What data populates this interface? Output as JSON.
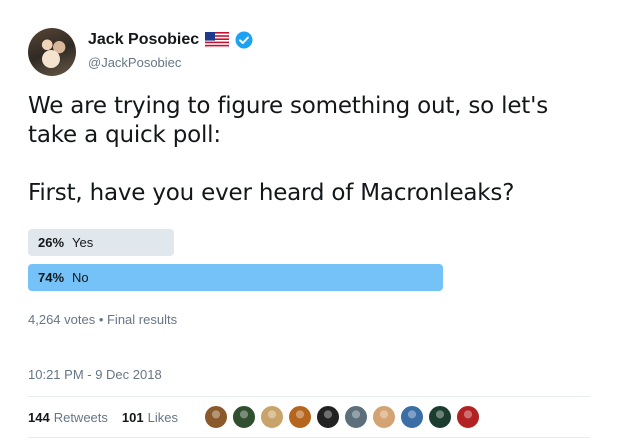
{
  "author": {
    "display_name": "Jack Posobiec",
    "handle": "@JackPosobiec",
    "flag_icon": "us-flag-icon",
    "verified_icon": "verified-badge-icon"
  },
  "tweet": {
    "text": "We are trying to figure something out, so let's take a quick poll:\n\nFirst, have you ever heard of Macronleaks?"
  },
  "poll": {
    "options": [
      {
        "percent_label": "26%",
        "label": "Yes",
        "fraction": 0.26
      },
      {
        "percent_label": "74%",
        "label": "No",
        "fraction": 0.74
      }
    ],
    "meta": "4,264 votes • Final results"
  },
  "timestamp": "10:21 PM - 9 Dec 2018",
  "stats": {
    "retweets_count": "144",
    "retweets_label": "Retweets",
    "likes_count": "101",
    "likes_label": "Likes"
  },
  "likers": [
    {
      "icon": "liker-avatar-icon",
      "color": "#8a5a2b"
    },
    {
      "icon": "liker-avatar-icon",
      "color": "#2f4f2f"
    },
    {
      "icon": "liker-avatar-icon",
      "color": "#c9a46a"
    },
    {
      "icon": "liker-avatar-icon",
      "color": "#b5651d"
    },
    {
      "icon": "liker-avatar-icon",
      "color": "#222222"
    },
    {
      "icon": "liker-avatar-icon",
      "color": "#5c6f7a"
    },
    {
      "icon": "liker-avatar-icon",
      "color": "#d4a373"
    },
    {
      "icon": "liker-avatar-icon",
      "color": "#3b6ea5"
    },
    {
      "icon": "liker-avatar-icon",
      "color": "#1b3d2f"
    },
    {
      "icon": "liker-avatar-icon",
      "color": "#b22222"
    }
  ],
  "colors": {
    "bar_winner": "#74c2f8",
    "bar_other": "#e1e8ed",
    "secondary_text": "#657786"
  }
}
